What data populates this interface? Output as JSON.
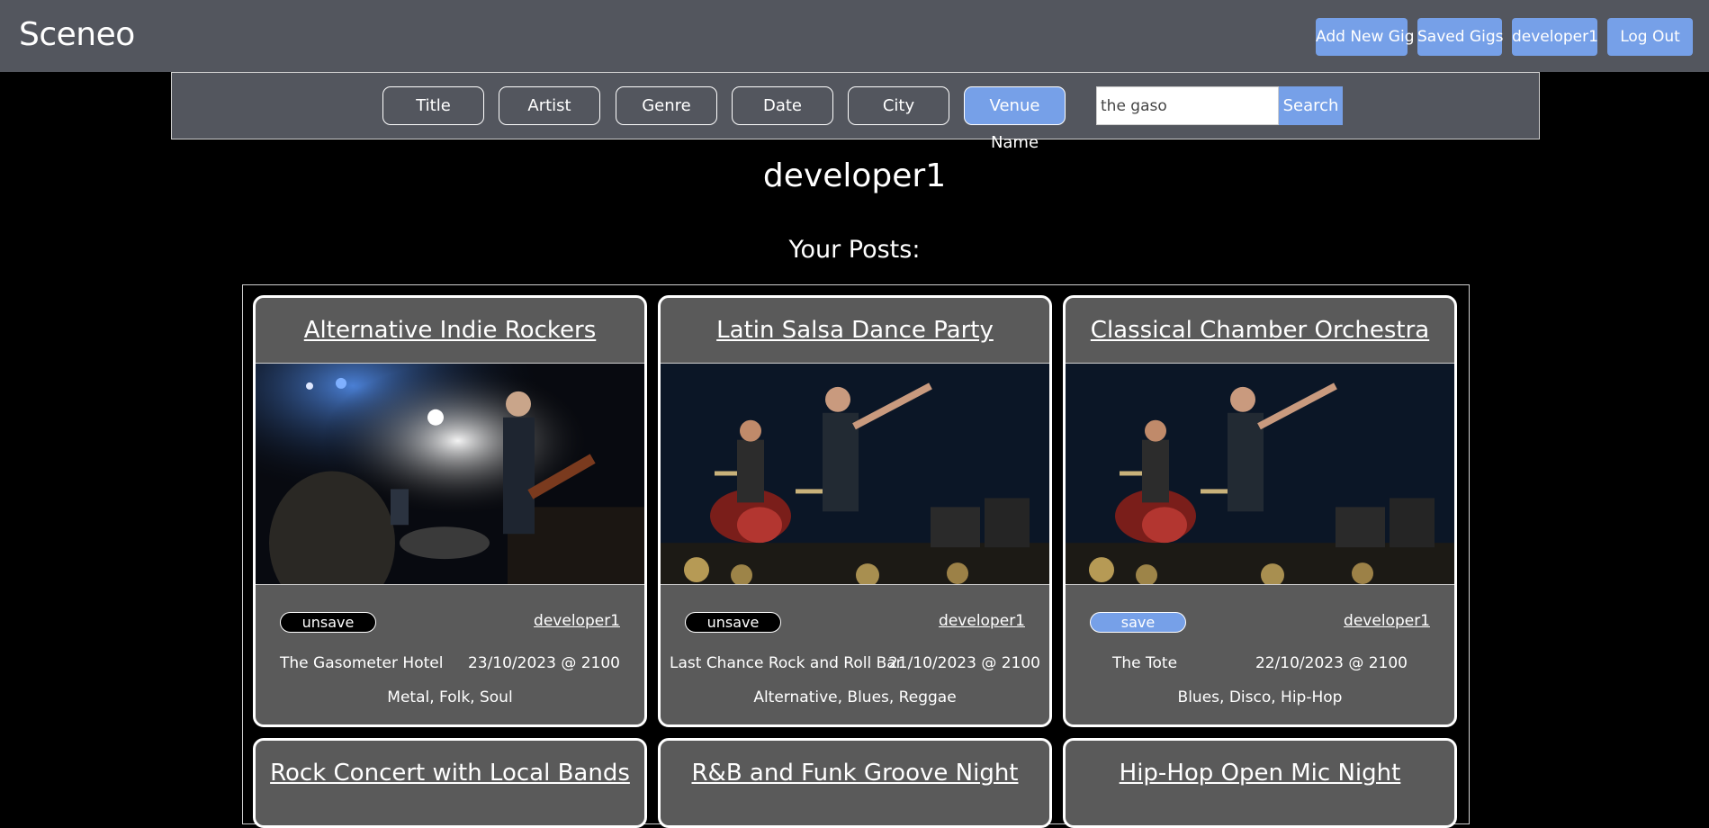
{
  "header": {
    "brand": "Sceneo",
    "nav": {
      "add_new_gig": "Add New Gig",
      "saved_gigs": "Saved Gigs",
      "profile": "developer1",
      "log_out": "Log Out"
    }
  },
  "filters": {
    "title": "Title",
    "artist": "Artist",
    "genre": "Genre",
    "date": "Date",
    "city": "City",
    "venue_name": "Venue Name",
    "active": "Venue Name",
    "search_value": "the gaso",
    "search_button": "Search"
  },
  "profile": {
    "username": "developer1",
    "section_title": "Your Posts:"
  },
  "posts": [
    {
      "title": "Alternative Indie Rockers",
      "save_label": "unsave",
      "author": "developer1",
      "venue": "The Gasometer Hotel",
      "datetime": "23/10/2023 @ 2100",
      "genres": "Metal, Folk, Soul"
    },
    {
      "title": "Latin Salsa Dance Party",
      "save_label": "unsave",
      "author": "developer1",
      "venue": "Last Chance Rock and Roll Bar",
      "datetime": "21/10/2023 @ 2100",
      "genres": "Alternative, Blues, Reggae"
    },
    {
      "title": "Classical Chamber Orchestra",
      "save_label": "save",
      "author": "developer1",
      "venue": "The Tote",
      "datetime": "22/10/2023 @ 2100",
      "genres": "Blues, Disco, Hip-Hop"
    },
    {
      "title": "Rock Concert with Local Bands"
    },
    {
      "title": "R&B and Funk Groove Night"
    },
    {
      "title": "Hip-Hop Open Mic Night"
    }
  ],
  "colors": {
    "header_bg": "#53565e",
    "accent": "#76a0e8",
    "card_bg": "#5a5a5a",
    "page_bg": "#000000"
  }
}
